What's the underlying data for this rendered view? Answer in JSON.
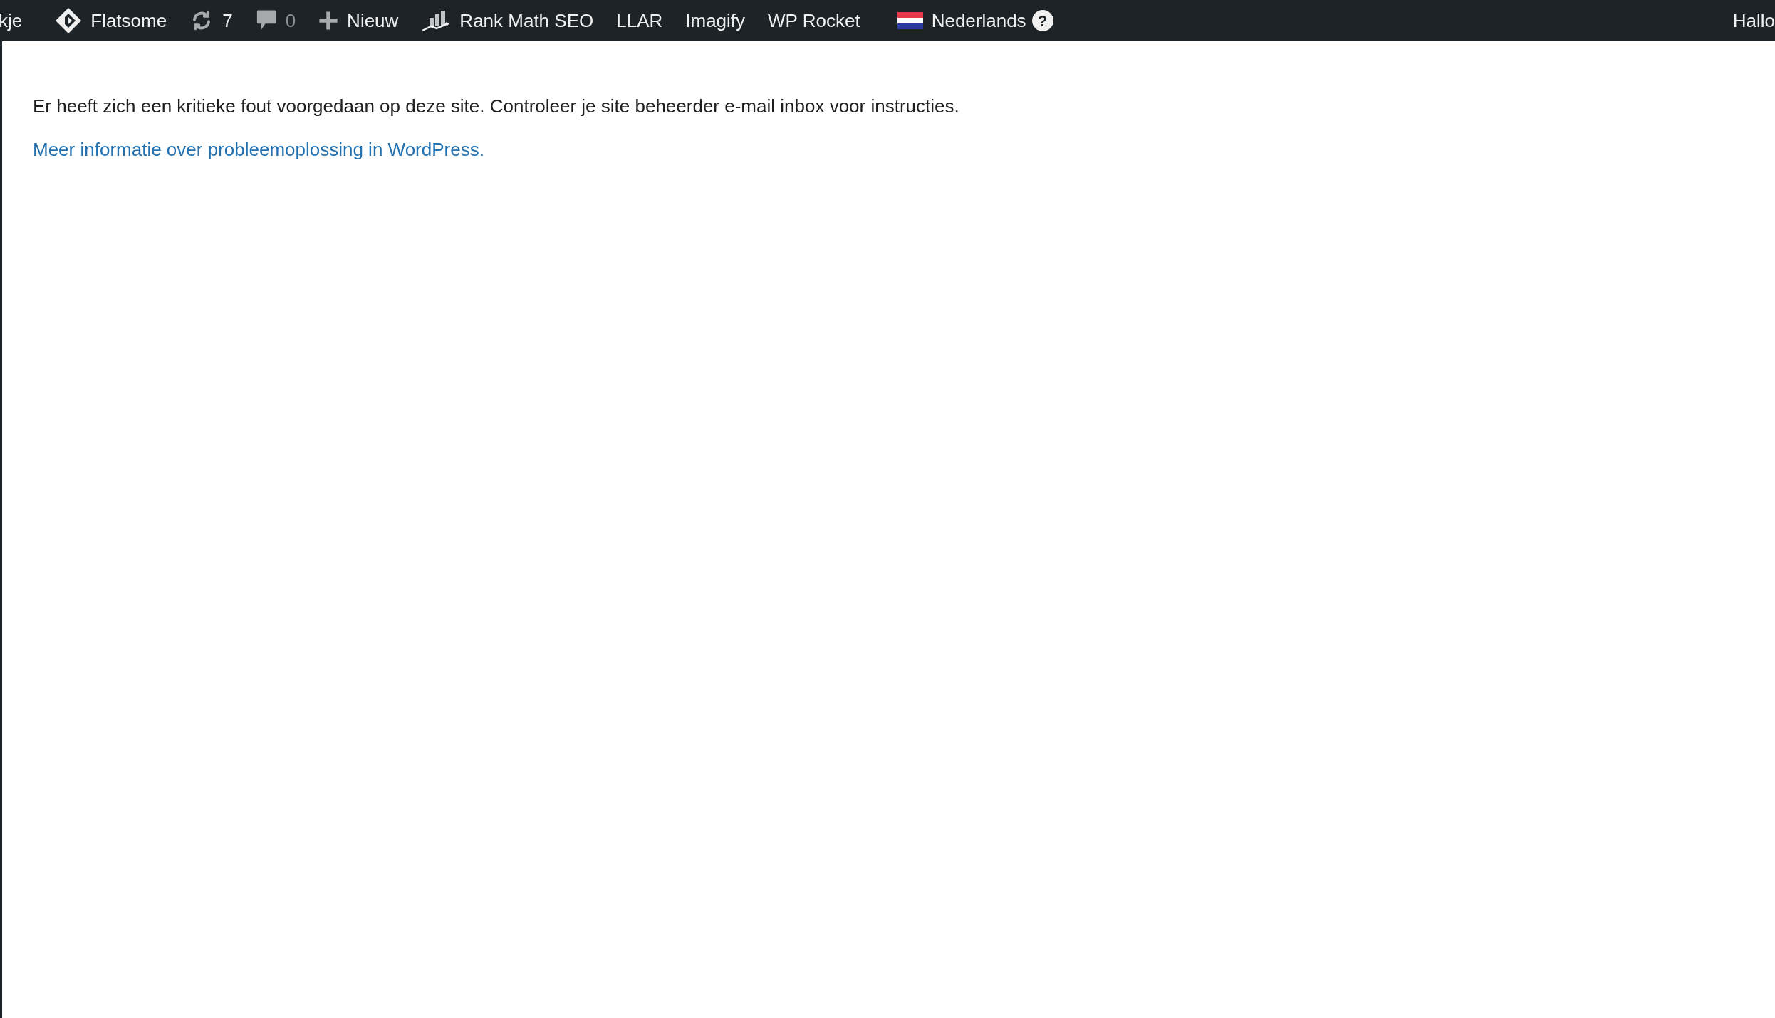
{
  "admin_bar": {
    "items": [
      {
        "kind": "site",
        "label": "kje"
      },
      {
        "kind": "theme",
        "label": "Flatsome"
      },
      {
        "kind": "updates",
        "label": "7"
      },
      {
        "kind": "comments",
        "label": "0"
      },
      {
        "kind": "new",
        "label": "Nieuw"
      },
      {
        "kind": "seo",
        "label": "Rank Math SEO"
      },
      {
        "kind": "text",
        "label": "LLAR"
      },
      {
        "kind": "text",
        "label": "Imagify"
      },
      {
        "kind": "text",
        "label": "WP Rocket"
      },
      {
        "kind": "language",
        "label": "Nederlands"
      },
      {
        "kind": "help",
        "label": "?"
      }
    ],
    "account": {
      "label": "Hallo"
    }
  },
  "message": {
    "text": "Er heeft zich een kritieke fout voorgedaan op deze site. Controleer je site beheerder e-mail inbox voor instructies.",
    "link": "Meer informatie over probleemoplossing in WordPress."
  }
}
